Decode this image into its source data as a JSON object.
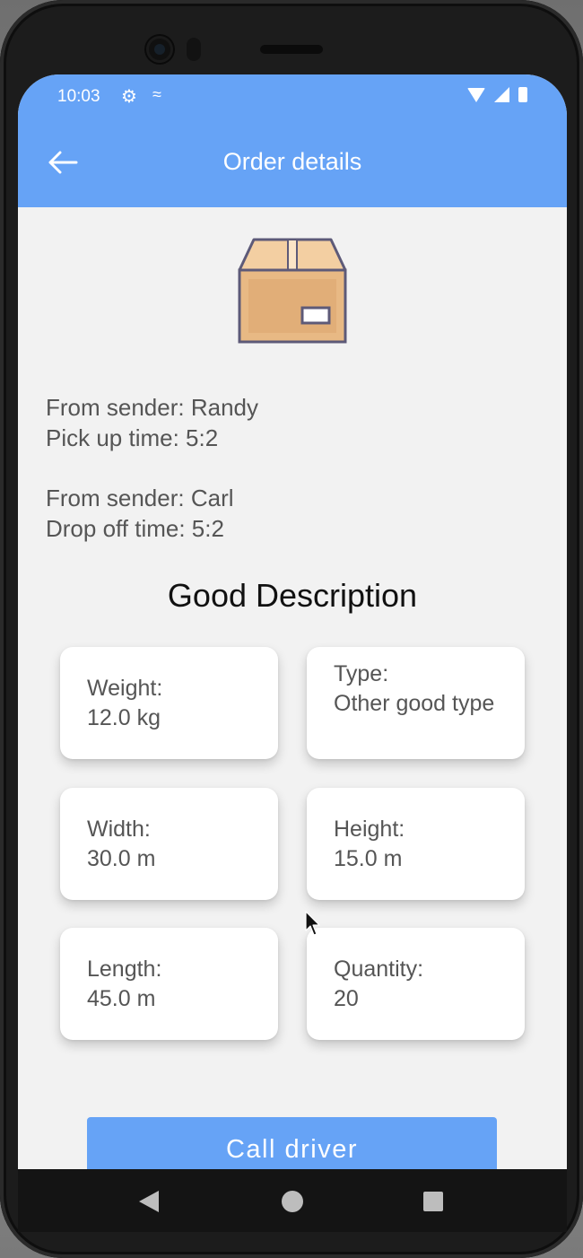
{
  "status_bar": {
    "time": "10:03",
    "gear_glyph": "⚙",
    "wave_glyph": "≈"
  },
  "app_bar": {
    "title": "Order details",
    "back_icon": "arrow-left"
  },
  "pickup": {
    "sender_line": "From sender: Randy",
    "time_line": "Pick up time: 5:2"
  },
  "dropoff": {
    "sender_line": "From sender: Carl",
    "time_line": "Drop off time: 5:2"
  },
  "good_description": {
    "title": "Good Description",
    "cards": [
      {
        "label": "Weight:",
        "value": "12.0 kg"
      },
      {
        "label": "Type:",
        "value": "Other good type"
      },
      {
        "label": "Width:",
        "value": "30.0 m"
      },
      {
        "label": "Height:",
        "value": "15.0 m"
      },
      {
        "label": "Length:",
        "value": "45.0 m"
      },
      {
        "label": "Quantity:",
        "value": "20"
      }
    ]
  },
  "actions": {
    "call_driver_label": "Call driver"
  },
  "colors": {
    "primary": "#66a3f6",
    "background": "#f2f2f2",
    "box_fill": "#e8b984",
    "box_outline": "#5d5a78"
  }
}
